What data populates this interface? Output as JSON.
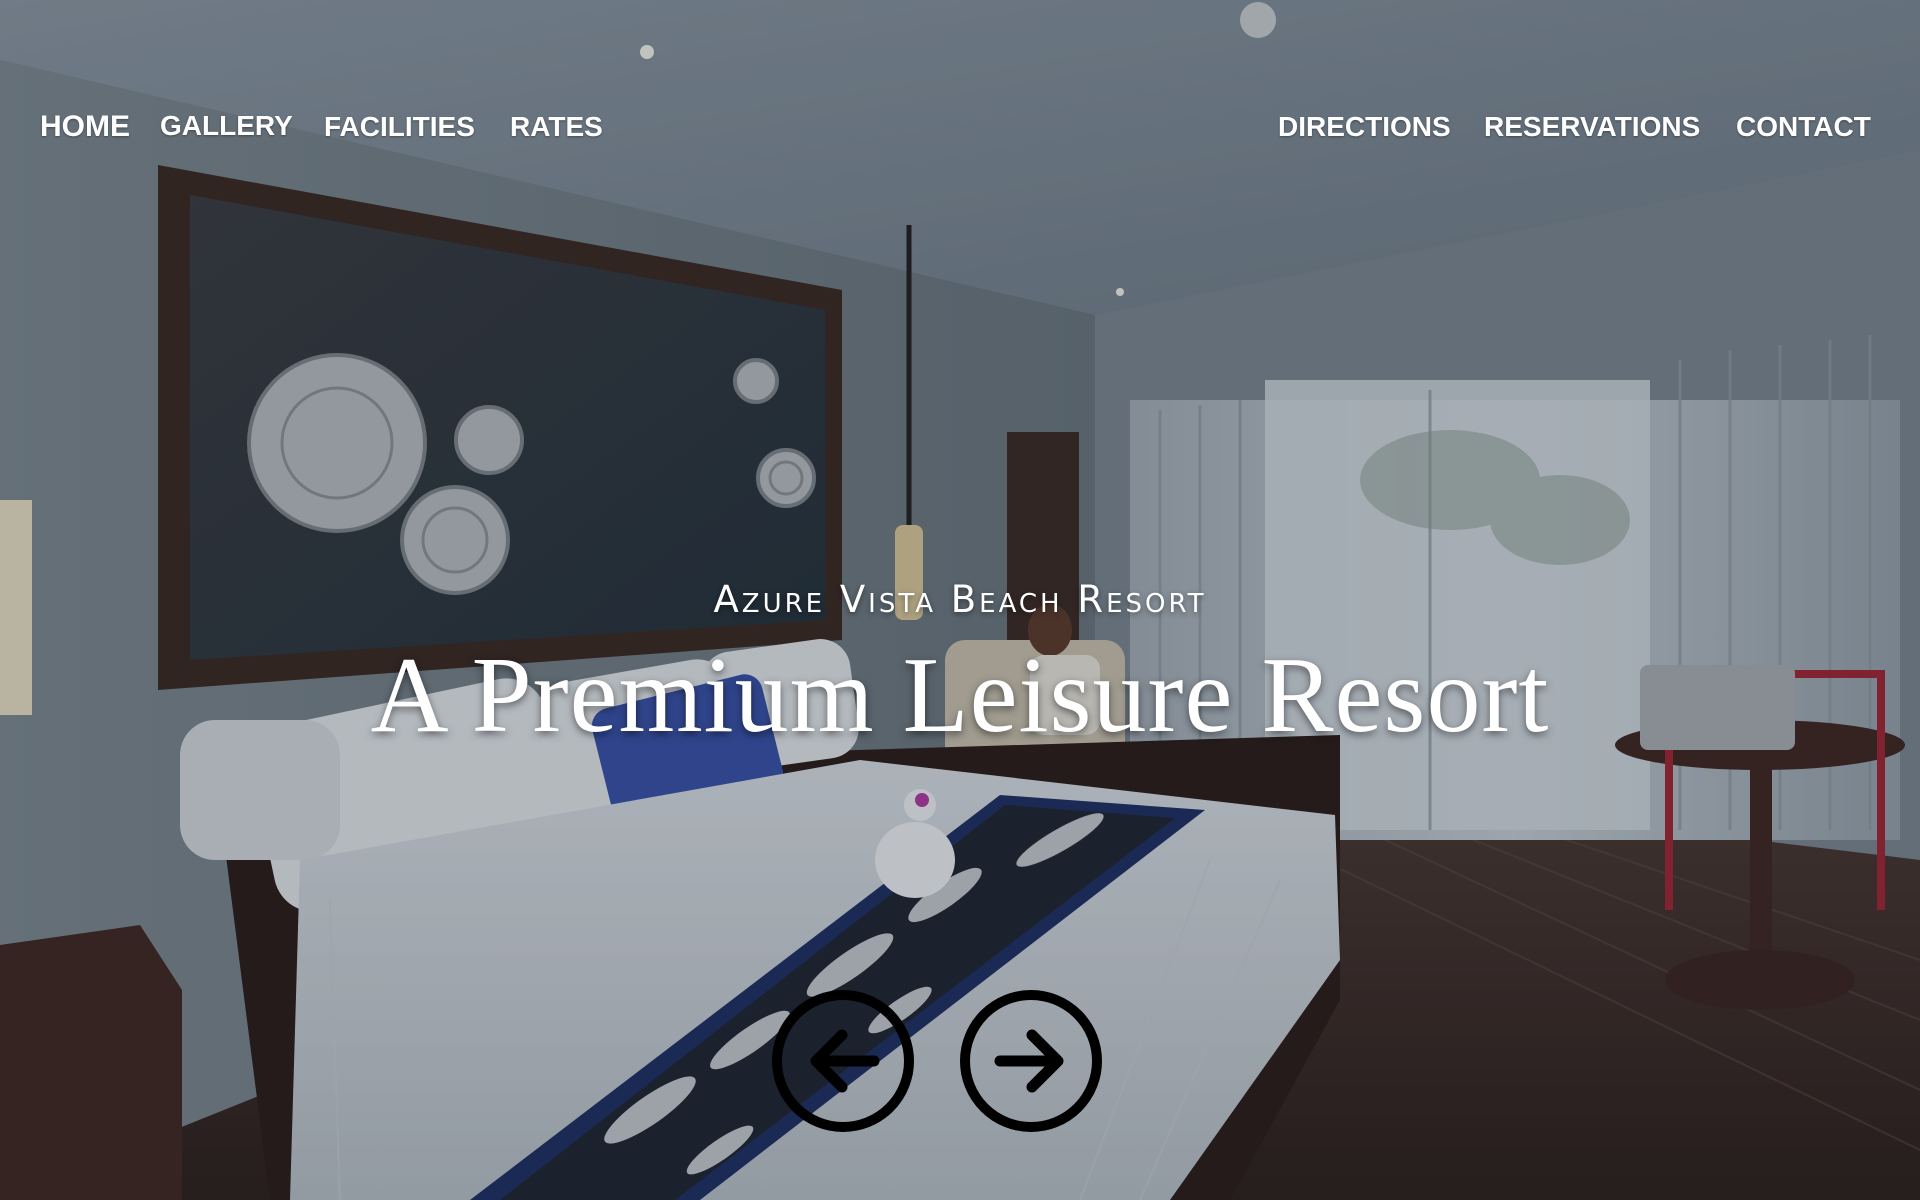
{
  "nav": {
    "left": [
      "HOME",
      "GALLERY",
      "FACILITIES",
      "RATES"
    ],
    "right": [
      "DIRECTIONS",
      "RESERVATIONS",
      "CONTACT"
    ],
    "active": "HOME"
  },
  "hero": {
    "subtitle": "Azure Vista Beach Resort",
    "title": "A Premium Leisure Resort"
  },
  "carousel": {
    "prev_icon": "arrow-left-icon",
    "next_icon": "arrow-right-icon"
  },
  "colors": {
    "nav_text": "#ffffff",
    "hero_text": "#ffffff",
    "arrow_border": "#000000"
  }
}
